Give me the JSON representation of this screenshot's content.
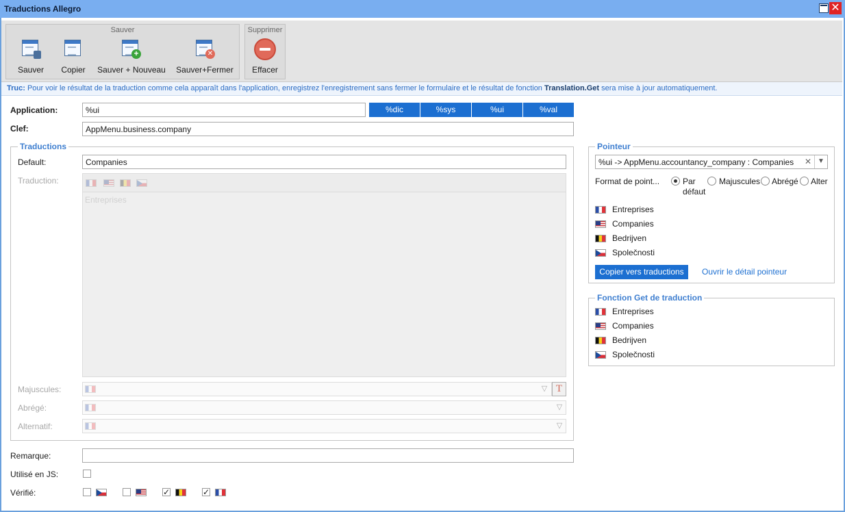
{
  "window": {
    "title": "Traductions Allegro"
  },
  "ribbon": {
    "group_save_title": "Sauver",
    "group_delete_title": "Supprimer",
    "save": "Sauver",
    "copy": "Copier",
    "save_new": "Sauver + Nouveau",
    "save_close": "Sauver+Fermer",
    "delete": "Effacer"
  },
  "tip": {
    "label": "Truc:",
    "text_before": " Pour voir le résultat de la traduction comme cela apparaît dans l'application, enregistrez l'enregistrement sans fermer le formulaire et le résultat de fonction ",
    "function_name": "Translation.Get",
    "text_after": " sera mise à jour automatiquement."
  },
  "form": {
    "application_label": "Application:",
    "application_value": "%ui",
    "key_label": "Clef:",
    "key_value": "AppMenu.business.company",
    "prefix_buttons": [
      "%dic",
      "%sys",
      "%ui",
      "%val"
    ],
    "remark_label": "Remarque:",
    "remark_value": "",
    "used_js_label": "Utilisé en JS:",
    "verified_label": "Vérifié:",
    "verified": [
      {
        "flag": "cz",
        "checked": false
      },
      {
        "flag": "us",
        "checked": false
      },
      {
        "flag": "be",
        "checked": true
      },
      {
        "flag": "fr",
        "checked": true
      }
    ]
  },
  "translations": {
    "title": "Traductions",
    "default_label": "Default:",
    "default_value": "Companies",
    "translation_label": "Traduction:",
    "translation_value": "Entreprises",
    "uppercase_label": "Majuscules:",
    "abbr_label": "Abrégé:",
    "alt_label": "Alternatif:"
  },
  "pointer": {
    "title": "Pointeur",
    "value": "%ui -> AppMenu.accountancy_company : Companies",
    "format_label": "Format de point...",
    "format_options": [
      "Par défaut",
      "Majuscules",
      "Abrégé",
      "Alter"
    ],
    "format_selected": "Par défaut",
    "translations": [
      {
        "flag": "fr",
        "text": "Entreprises"
      },
      {
        "flag": "us",
        "text": "Companies"
      },
      {
        "flag": "be",
        "text": "Bedrijven"
      },
      {
        "flag": "cz",
        "text": "Společnosti"
      }
    ],
    "copy_button": "Copier vers traductions",
    "open_link": "Ouvrir le détail pointeur"
  },
  "get_function": {
    "title": "Fonction Get de traduction",
    "translations": [
      {
        "flag": "fr",
        "text": "Entreprises"
      },
      {
        "flag": "us",
        "text": "Companies"
      },
      {
        "flag": "be",
        "text": "Bedrijven"
      },
      {
        "flag": "cz",
        "text": "Společnosti"
      }
    ]
  },
  "colors": {
    "titlebar": "#79aef0",
    "accent": "#1c6fd1",
    "close": "#e02424",
    "section_title": "#3f7fd0"
  }
}
